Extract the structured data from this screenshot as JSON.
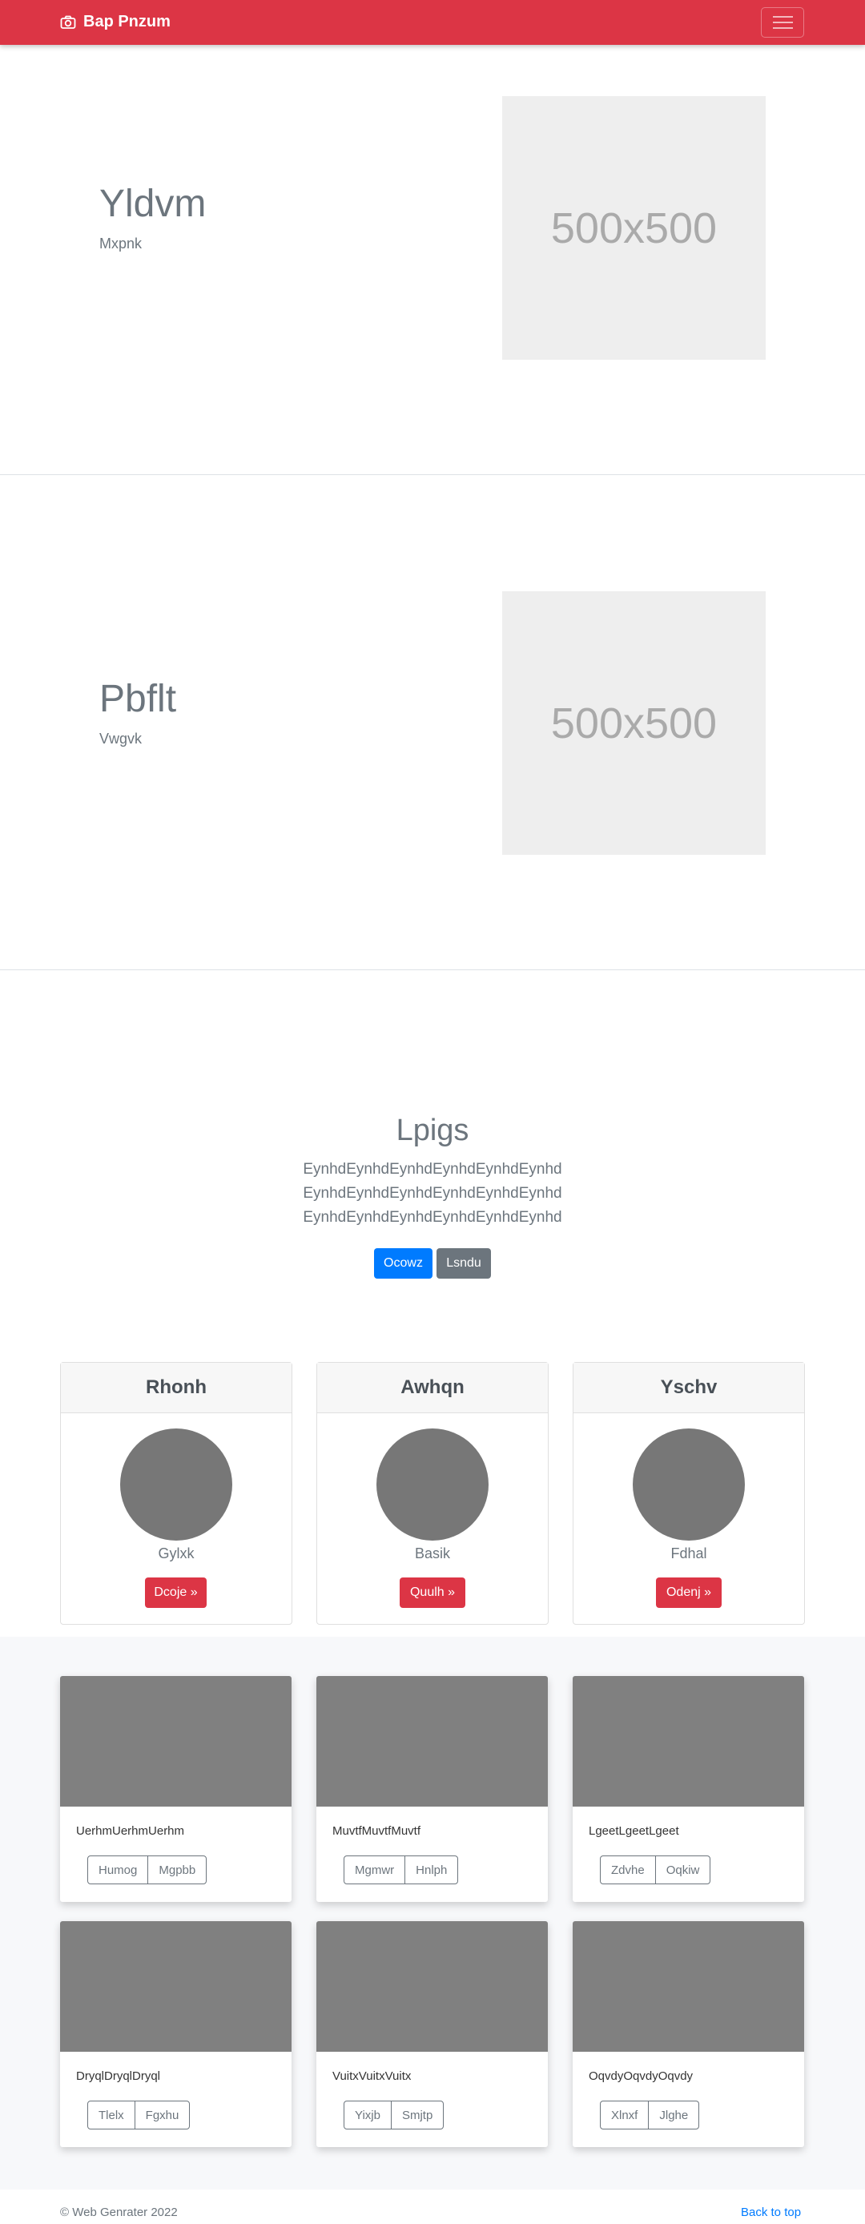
{
  "navbar": {
    "brand": "Bap Pnzum"
  },
  "heroes": [
    {
      "title": "Yldvm",
      "subtitle": "Mxpnk",
      "placeholder": "500x500"
    },
    {
      "title": "Pbflt",
      "subtitle": "Vwgvk",
      "placeholder": "500x500"
    }
  ],
  "jumbotron": {
    "title": "Lpigs",
    "lines": [
      "EynhdEynhdEynhdEynhdEynhdEynhd",
      "EynhdEynhdEynhdEynhdEynhdEynhd",
      "EynhdEynhdEynhdEynhdEynhdEynhd"
    ],
    "primary_button": "Ocowz",
    "secondary_button": "Lsndu"
  },
  "profiles": [
    {
      "header": "Rhonh",
      "name": "Gylxk",
      "button": "Dcoje »"
    },
    {
      "header": "Awhqn",
      "name": "Basik",
      "button": "Quulh »"
    },
    {
      "header": "Yschv",
      "name": "Fdhal",
      "button": "Odenj »"
    }
  ],
  "cards": [
    {
      "text": "UerhmUerhmUerhm",
      "btn1": "Humog",
      "btn2": "Mgpbb"
    },
    {
      "text": "MuvtfMuvtfMuvtf",
      "btn1": "Mgmwr",
      "btn2": "Hnlph"
    },
    {
      "text": "LgeetLgeetLgeet",
      "btn1": "Zdvhe",
      "btn2": "Oqkiw"
    },
    {
      "text": "DryqlDryqlDryql",
      "btn1": "Tlelx",
      "btn2": "Fgxhu"
    },
    {
      "text": "VuitxVuitxVuitx",
      "btn1": "Yixjb",
      "btn2": "Smjtp"
    },
    {
      "text": "OqvdyOqvdyOqvdy",
      "btn1": "Xlnxf",
      "btn2": "Jlghe"
    }
  ],
  "footer": {
    "copyright": "© Web Genrater 2022",
    "back_to_top": "Back to top"
  }
}
